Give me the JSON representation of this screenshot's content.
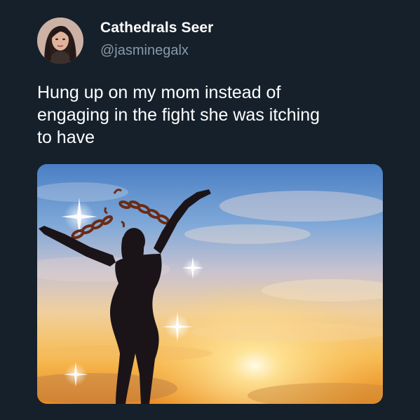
{
  "tweet": {
    "display_name": "Cathedrals Seer",
    "handle": "@jasminegalx",
    "text_lines": [
      "Hung up on my mom instead of",
      "engaging in the fight she was itching",
      "to have"
    ]
  },
  "icons": {
    "avatar": "profile-photo",
    "media": "silhouette-breaking-chains-sunset"
  },
  "colors": {
    "background": "#15202b",
    "name": "#ffffff",
    "handle": "#8899a6",
    "text": "#ffffff"
  }
}
